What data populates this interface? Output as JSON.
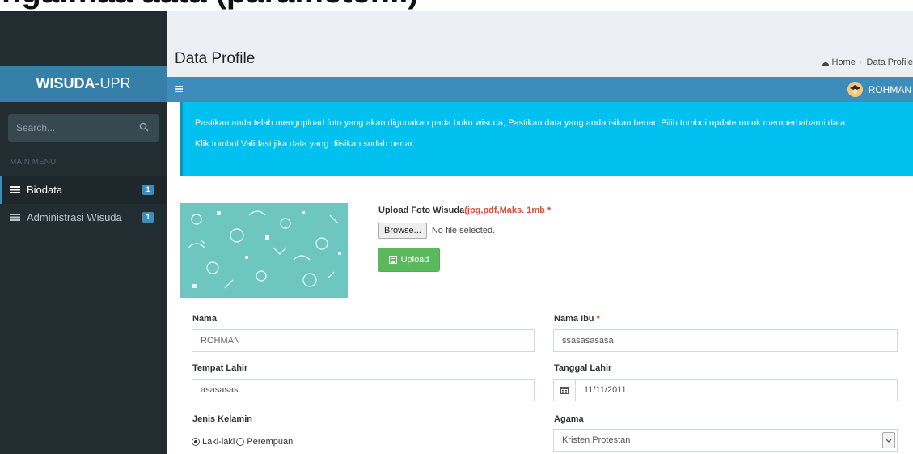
{
  "caption": {
    "text": "ngaimaa aata (parameter...)"
  },
  "sidebar": {
    "brand_bold": "WISUDA",
    "brand_rest": "-UPR",
    "search_placeholder": "Search...",
    "menu_header": "MAIN MENU",
    "items": [
      {
        "label": "Biodata",
        "badge": "1",
        "active": true
      },
      {
        "label": "Administrasi Wisuda",
        "badge": "1",
        "active": false
      }
    ]
  },
  "header": {
    "page_title": "Data Profile",
    "breadcrumb": [
      "Home",
      "Data Profile"
    ]
  },
  "navbar": {
    "user_name": "ROHMAN"
  },
  "alert": {
    "line1": "Pastikan anda telah mengupload foto yang akan digunakan pada buku wisuda, Pastikan data yang anda isikan benar, Pilih tomboi update untuk memperbaharui data.",
    "line2": "Klik tombol Validasi jika data yang diisikan sudah benar."
  },
  "upload": {
    "label": "Upload Foto Wisuda",
    "label_red": "(jpg,pdf,Maks. 1mb *",
    "browse_label": "Browse...",
    "file_status": "No file selected.",
    "button_label": "Upload"
  },
  "form": {
    "nama_label": "Nama",
    "nama_value": "ROHMAN",
    "nama_ibu_label": "Nama Ibu",
    "nama_ibu_req": "*",
    "nama_ibu_value": "ssasasasasa",
    "tempat_lahir_label": "Tempat Lahir",
    "tempat_lahir_value": "asasasas",
    "tanggal_lahir_label": "Tanggal Lahir",
    "tanggal_lahir_value": "11/11/2011",
    "jenis_kelamin_label": "Jenis Kelamin",
    "gender_options": [
      "Laki-laki",
      "Perempuan"
    ],
    "gender_selected": "Laki-laki",
    "agama_label": "Agama",
    "agama_value": "Kristen Protestan"
  },
  "colors": {
    "sidebar_bg": "#222d32",
    "brand_bg": "#367fa9",
    "navbar_bg": "#3c8dbc",
    "alert_bg": "#00c0ef",
    "upload_button_bg": "#5cb85c",
    "required_red": "#dd4b39"
  }
}
